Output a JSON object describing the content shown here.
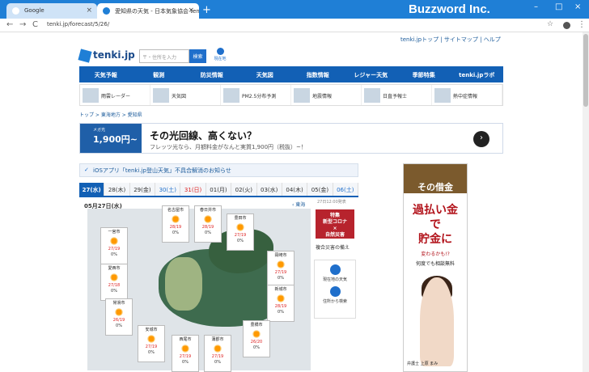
{
  "browser": {
    "tabs": [
      {
        "label": "Google",
        "close": "×"
      },
      {
        "label": "愛知県の天気 - 日本気象協会 tenki.jp",
        "close": "×"
      }
    ],
    "new_tab": "+",
    "watermark": "Buzzword Inc.",
    "url": "tenki.jp/forecast/5/26/",
    "nav": {
      "back": "←",
      "forward": "→",
      "reload": "C"
    },
    "window": {
      "minimize": "–",
      "maximize": "□",
      "close": "×"
    }
  },
  "header": {
    "toplinks": "tenki.jpトップ | サイトマップ | ヘルプ",
    "logo": "tenki.jp",
    "search_placeholder": "〒・住所を入力",
    "search_button": "検索",
    "current_location": "現在地"
  },
  "gnav": [
    "天気予報",
    "観測",
    "防災情報",
    "天気図",
    "指数情報",
    "レジャー天気",
    "季節特集",
    "tenki.jpラボ"
  ],
  "subnav": [
    "雨雲レーダー",
    "天気図",
    "PM2.5分布予測",
    "地震情報",
    "日直予報士",
    "熱中症情報"
  ],
  "breadcrumb": "トップ > 東海地方 > 愛知県",
  "ad_banner": {
    "logo": "メガ光",
    "price": "1,900円~",
    "headline": "その光回線、高くない？",
    "sub": "フレッツ光なら、月額料金がなんと実質1,900円（税抜）~！",
    "arrow": "›"
  },
  "notice": "iOSアプリ「tenki.jp登山天気」不具合解消のお知らせ",
  "days": [
    "27(水)",
    "28(木)",
    "29(金)",
    "30(土)",
    "31(日)",
    "01(月)",
    "02(火)",
    "03(水)",
    "04(木)",
    "05(金)",
    "06(土)"
  ],
  "forecast": {
    "date": "05月27日(水)",
    "region_link": "‹ 東海",
    "issued": "27日12:00発表",
    "cities": [
      {
        "name": "名古屋市",
        "temp": "28/19",
        "pop": "0%"
      },
      {
        "name": "春日井市",
        "temp": "28/19",
        "pop": "0%"
      },
      {
        "name": "豊田市",
        "temp": "27/19",
        "pop": "0%"
      },
      {
        "name": "一宮市",
        "temp": "27/19",
        "pop": "0%"
      },
      {
        "name": "岡崎市",
        "temp": "27/19",
        "pop": "0%"
      },
      {
        "name": "愛西市",
        "temp": "27/18",
        "pop": "0%"
      },
      {
        "name": "新城市",
        "temp": "28/19",
        "pop": "0%"
      },
      {
        "name": "常滑市",
        "temp": "26/19",
        "pop": "0%"
      },
      {
        "name": "安城市",
        "temp": "27/19",
        "pop": "0%"
      },
      {
        "name": "西尾市",
        "temp": "27/19",
        "pop": "0%"
      },
      {
        "name": "蒲郡市",
        "temp": "27/19",
        "pop": "0%"
      },
      {
        "name": "豊橋市",
        "temp": "26/20",
        "pop": "0%"
      }
    ]
  },
  "sidebar": {
    "corona_tag": "特集",
    "corona": "新型コロナ",
    "corona2": "×",
    "corona3": "自然災害",
    "fukugo": "複合災害の備え",
    "current_weather": "現在地の天気",
    "address_search": "住所から検索"
  },
  "ad_side": {
    "top": "その借金",
    "big1": "過払い金",
    "big2": "で",
    "big3": "貯金に",
    "big4": "変わるかも!?",
    "small": "何度でも相談無料",
    "caption": "弁護士 上原 まみ"
  }
}
